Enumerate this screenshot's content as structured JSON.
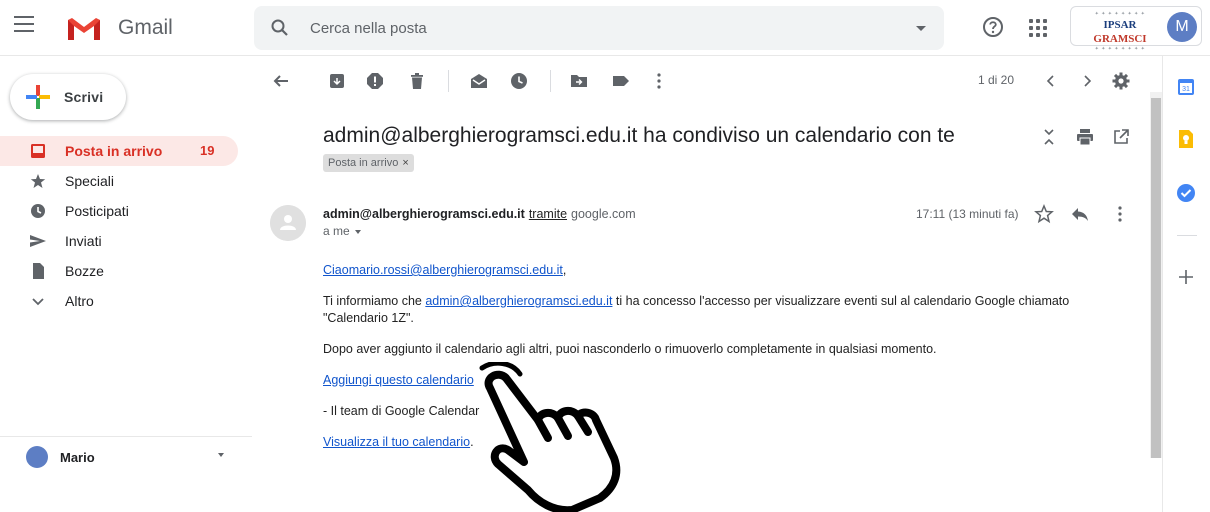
{
  "header": {
    "app_name": "Gmail",
    "search_placeholder": "Cerca nella posta",
    "org_name_left": "IPSAR",
    "org_name_right": "GRAMSCI",
    "avatar_letter": "M"
  },
  "sidebar": {
    "compose_label": "Scrivi",
    "items": [
      {
        "label": "Posta in arrivo",
        "count": "19",
        "icon": "inbox-icon",
        "active": true
      },
      {
        "label": "Speciali",
        "count": "",
        "icon": "star-icon",
        "active": false
      },
      {
        "label": "Posticipati",
        "count": "",
        "icon": "clock-icon",
        "active": false
      },
      {
        "label": "Inviati",
        "count": "",
        "icon": "send-icon",
        "active": false
      },
      {
        "label": "Bozze",
        "count": "",
        "icon": "draft-icon",
        "active": false
      },
      {
        "label": "Altro",
        "count": "",
        "icon": "chevron-down-icon",
        "active": false
      }
    ],
    "hangouts_user": "Mario"
  },
  "toolbar": {
    "pager": "1 di 20"
  },
  "message": {
    "subject": "admin@alberghierogramsci.edu.it ha condiviso un calendario con te",
    "label_chip": "Posta in arrivo",
    "label_chip_remove": "×",
    "sender": "admin@alberghierogramsci.edu.it",
    "via_label": "tramite",
    "via_domain": "google.com",
    "recipient": "a me",
    "time": "17:11 (13 minuti fa)",
    "greeting_link": "Ciaomario.rossi@alberghierogramsci.edu.it",
    "greeting_end": ",",
    "p1_before": "Ti informiamo che ",
    "p1_link": "admin@alberghierogramsci.edu.it",
    "p1_after": " ti ha concesso l'accesso per visualizzare eventi sul al calendario Google chiamato \"Calendario 1Z\".",
    "p2": "Dopo aver aggiunto il calendario agli altri, puoi nasconderlo o rimuoverlo completamente in qualsiasi momento.",
    "add_link": "Aggiungi questo calendario",
    "team_text": "- Il team di Google Calendar",
    "view_link": "Visualizza il tuo calendario",
    "view_end": "."
  },
  "colors": {
    "accent_red": "#d93025",
    "active_bg": "#fce8e6",
    "link": "#1155cc"
  }
}
